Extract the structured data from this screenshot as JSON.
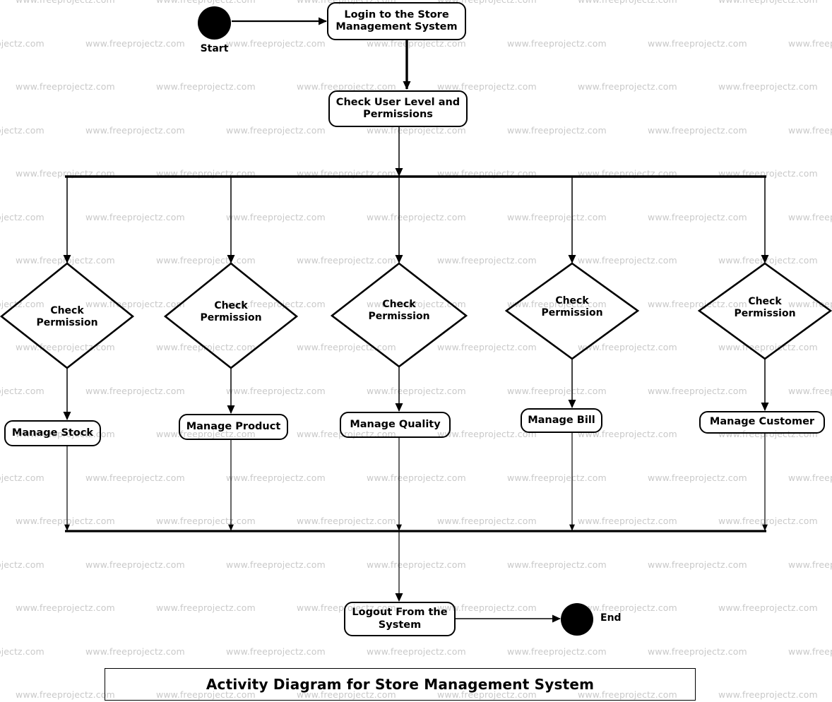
{
  "diagram": {
    "title": "Activity Diagram for Store Management System",
    "watermark_text": "www.freeprojectz.com",
    "colors": {
      "stroke": "#000000",
      "fill": "#ffffff",
      "watermark": "#c9c9c9"
    },
    "start": {
      "label": "Start"
    },
    "end": {
      "label": "End"
    },
    "activities": {
      "login": "Login to the Store Management System",
      "check_user": "Check User Level and Permissions",
      "logout": "Logout From the System"
    },
    "branches": [
      {
        "decision": "Check Permission",
        "activity": "Manage Stock"
      },
      {
        "decision": "Check Permission",
        "activity": "Manage Product"
      },
      {
        "decision": "Check Permission",
        "activity": "Manage Quality"
      },
      {
        "decision": "Check Permission",
        "activity": "Manage Bill"
      },
      {
        "decision": "Check Permission",
        "activity": "Manage Customer"
      }
    ]
  }
}
